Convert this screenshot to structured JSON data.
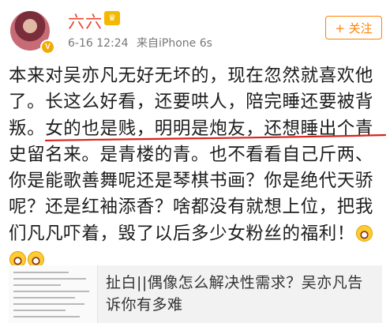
{
  "header": {
    "username": "六六",
    "crown_glyph": "♛",
    "verified_glyph": "V",
    "timestamp": "6-16 12:24",
    "source": "来自iPhone 6s",
    "follow_label": "+ 关注"
  },
  "post": {
    "lines": [
      "本来对吴亦凡无好无坏的，现在忽然就喜欢他",
      "了。长这么好看，还要哄人，陪完睡还要被背",
      "叛。女的也是贱，明明是炮友，还想睡出个青",
      "史留名来。是青楼的青。也不看看自己斤两、",
      "你是能歌善舞呢还是琴棋书画？你是绝代天骄",
      "呢？还是红袖添香？啥都没有就想上位，把我",
      "们凡凡吓着，毁了以后多少女粉丝的福利！"
    ],
    "emoji_name": "laughing-tears"
  },
  "quote": {
    "title": "扯白||偶像怎么解决性需求？吴亦凡告诉你有多难"
  },
  "colors": {
    "username": "#e8452c",
    "follow": "#ff8200",
    "underline": "#d9231d"
  }
}
